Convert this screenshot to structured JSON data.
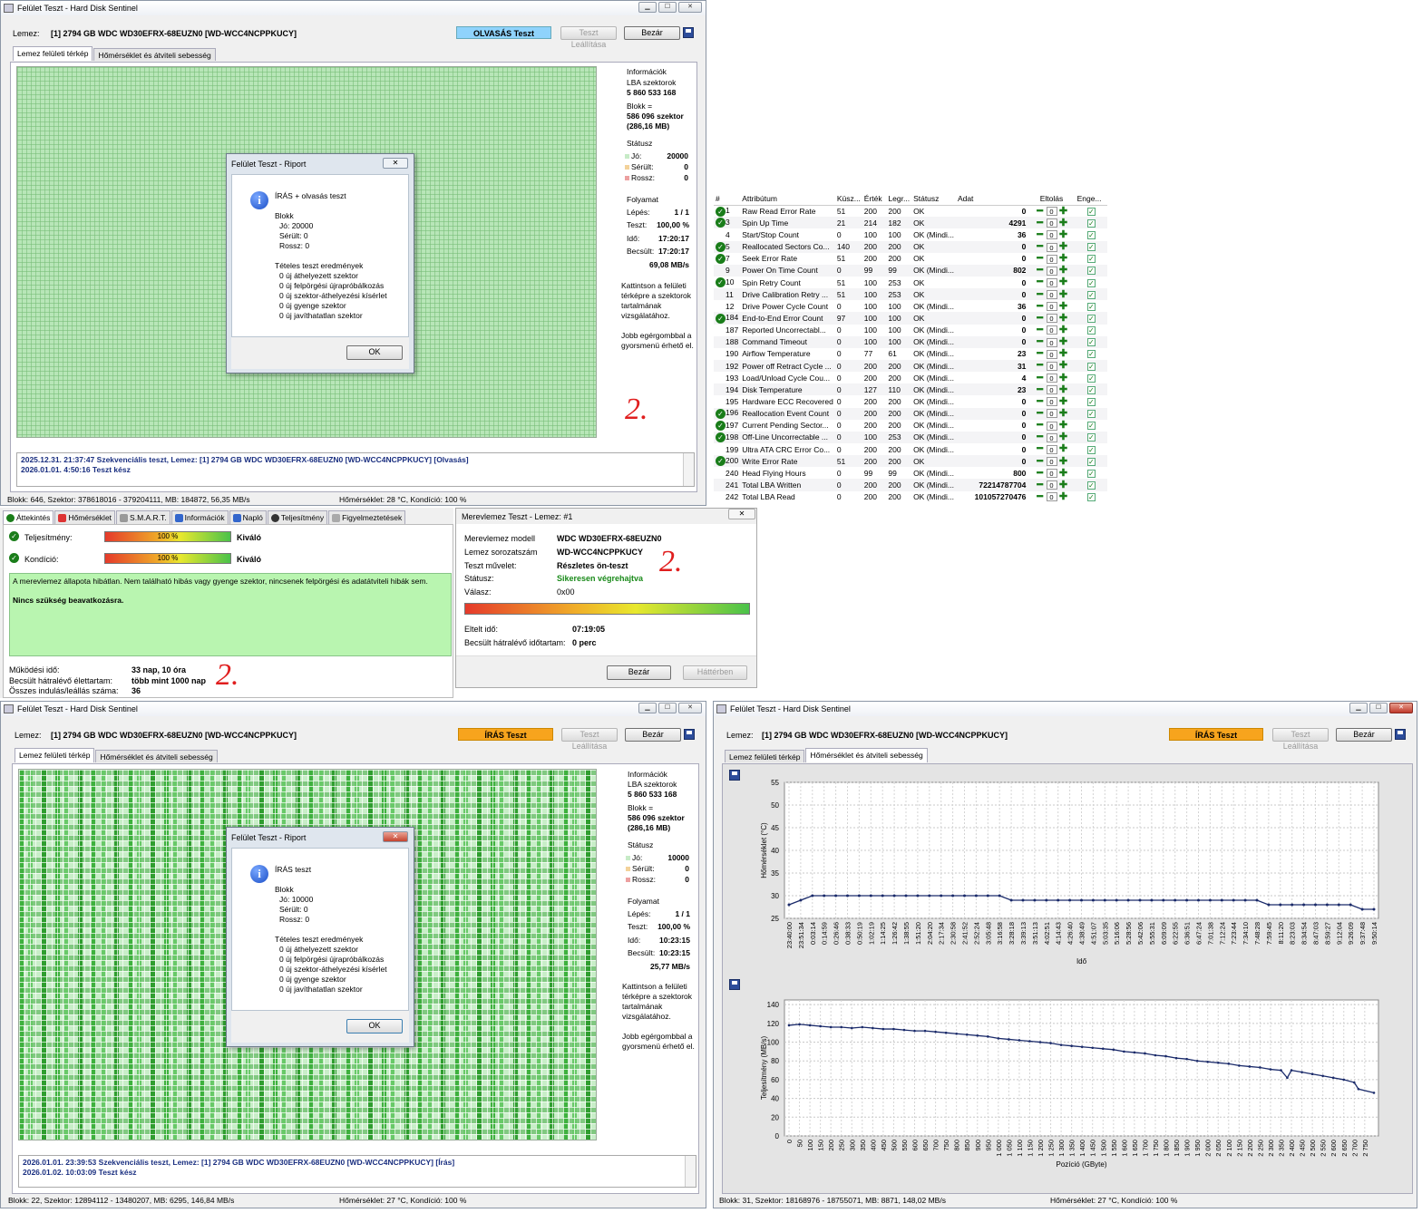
{
  "win_read": {
    "title": "Felület Teszt - Hard Disk Sentinel",
    "disk_label": "Lemez:",
    "disk_value": "[1] 2794 GB  WDC WD30EFRX-68EUZN0 [WD-WCC4NCPPKUCY]",
    "mode": "OLVASÁS Teszt",
    "stop": "Teszt Leállítása",
    "close": "Bezár",
    "tab1": "Lemez felületi térkép",
    "tab2": "Hőmérséklet és átviteli sebesség",
    "info_title": "Információk",
    "lba_label": "LBA szektorok",
    "lba_value": "5 860 533 168",
    "block_label": "Blokk =",
    "block_value1": "586 096 szektor",
    "block_value2": "(286,16 MB)",
    "status_title": "Státusz",
    "good_label": "Jó:",
    "good_value": "20000",
    "damaged_label": "Sérült:",
    "damaged_value": "0",
    "bad_label": "Rossz:",
    "bad_value": "0",
    "progress_title": "Folyamat",
    "step_label": "Lépés:",
    "step_value": "1 / 1",
    "test_label": "Teszt:",
    "test_value": "100,00 %",
    "time_label": "Idő:",
    "time_value": "17:20:17",
    "est_label": "Becsült:",
    "est_value": "17:20:17",
    "speed": "69,08 MB/s",
    "help1": "Kattintson a felületi térképre a szektorok tartalmának vizsgálatához.",
    "help2": "Jobb egérgombbal a gyorsmenü érhető el.",
    "log1": "2025.12.31.  21:37:47   Szekvenciális teszt, Lemez: [1] 2794 GB  WDC WD30EFRX-68EUZN0 [WD-WCC4NCPPKUCY] [Olvasás]",
    "log2": "2026.01.01.  4:50:16   Teszt kész",
    "status_left": "Blokk: 646, Szektor: 378618016 - 379204111, MB: 184872, 56,35 MB/s",
    "status_right": "Hőmérséklet: 28  °C,  Kondíció: 100 %",
    "handwritten": "2."
  },
  "dlg_read": {
    "title": "Felület Teszt - Riport",
    "line1": "ÍRÁS + olvasás teszt",
    "blocks": "Blokk",
    "good": "Jó: 20000",
    "damaged": "Sérült: 0",
    "bad": "Rossz: 0",
    "results": "Tételes teszt eredmények",
    "r1": "0 új áthelyezett szektor",
    "r2": "0 új felpörgési újrapróbálkozás",
    "r3": "0 új szektor-áthelyezési kísérlet",
    "r4": "0 új gyenge szektor",
    "r5": "0 új javíthatatlan szektor",
    "ok": "OK"
  },
  "smart": {
    "headers": [
      "#",
      "Attribútum",
      "Küsz...",
      "Érték",
      "Legr...",
      "Státusz",
      "Adat",
      "Eltolás",
      "Enge..."
    ],
    "rows": [
      {
        "ok": true,
        "id": "1",
        "name": "Raw Read Error Rate",
        "th": "51",
        "val": "200",
        "worst": "200",
        "st": "OK",
        "data": "0"
      },
      {
        "ok": true,
        "id": "3",
        "name": "Spin Up Time",
        "th": "21",
        "val": "214",
        "worst": "182",
        "st": "OK",
        "data": "4291"
      },
      {
        "ok": false,
        "id": "4",
        "name": "Start/Stop Count",
        "th": "0",
        "val": "100",
        "worst": "100",
        "st": "OK (Mindi...",
        "data": "36"
      },
      {
        "ok": true,
        "id": "5",
        "name": "Reallocated Sectors Co...",
        "th": "140",
        "val": "200",
        "worst": "200",
        "st": "OK",
        "data": "0"
      },
      {
        "ok": true,
        "id": "7",
        "name": "Seek Error Rate",
        "th": "51",
        "val": "200",
        "worst": "200",
        "st": "OK",
        "data": "0"
      },
      {
        "ok": false,
        "id": "9",
        "name": "Power On Time Count",
        "th": "0",
        "val": "99",
        "worst": "99",
        "st": "OK (Mindi...",
        "data": "802"
      },
      {
        "ok": true,
        "id": "10",
        "name": "Spin Retry Count",
        "th": "51",
        "val": "100",
        "worst": "253",
        "st": "OK",
        "data": "0"
      },
      {
        "ok": false,
        "id": "11",
        "name": "Drive Calibration Retry ...",
        "th": "51",
        "val": "100",
        "worst": "253",
        "st": "OK",
        "data": "0"
      },
      {
        "ok": false,
        "id": "12",
        "name": "Drive Power Cycle Count",
        "th": "0",
        "val": "100",
        "worst": "100",
        "st": "OK (Mindi...",
        "data": "36"
      },
      {
        "ok": true,
        "id": "184",
        "name": "End-to-End Error Count",
        "th": "97",
        "val": "100",
        "worst": "100",
        "st": "OK",
        "data": "0"
      },
      {
        "ok": false,
        "id": "187",
        "name": "Reported Uncorrectabl...",
        "th": "0",
        "val": "100",
        "worst": "100",
        "st": "OK (Mindi...",
        "data": "0"
      },
      {
        "ok": false,
        "id": "188",
        "name": "Command Timeout",
        "th": "0",
        "val": "100",
        "worst": "100",
        "st": "OK (Mindi...",
        "data": "0"
      },
      {
        "ok": false,
        "id": "190",
        "name": "Airflow Temperature",
        "th": "0",
        "val": "77",
        "worst": "61",
        "st": "OK (Mindi...",
        "data": "23"
      },
      {
        "ok": false,
        "id": "192",
        "name": "Power off Retract Cycle ...",
        "th": "0",
        "val": "200",
        "worst": "200",
        "st": "OK (Mindi...",
        "data": "31"
      },
      {
        "ok": false,
        "id": "193",
        "name": "Load/Unload Cycle Cou...",
        "th": "0",
        "val": "200",
        "worst": "200",
        "st": "OK (Mindi...",
        "data": "4"
      },
      {
        "ok": false,
        "id": "194",
        "name": "Disk Temperature",
        "th": "0",
        "val": "127",
        "worst": "110",
        "st": "OK (Mindi...",
        "data": "23"
      },
      {
        "ok": false,
        "id": "195",
        "name": "Hardware ECC Recovered",
        "th": "0",
        "val": "200",
        "worst": "200",
        "st": "OK (Mindi...",
        "data": "0"
      },
      {
        "ok": true,
        "id": "196",
        "name": "Reallocation Event Count",
        "th": "0",
        "val": "200",
        "worst": "200",
        "st": "OK (Mindi...",
        "data": "0"
      },
      {
        "ok": true,
        "id": "197",
        "name": "Current Pending Sector...",
        "th": "0",
        "val": "200",
        "worst": "200",
        "st": "OK (Mindi...",
        "data": "0"
      },
      {
        "ok": true,
        "id": "198",
        "name": "Off-Line Uncorrectable ...",
        "th": "0",
        "val": "100",
        "worst": "253",
        "st": "OK (Mindi...",
        "data": "0"
      },
      {
        "ok": false,
        "id": "199",
        "name": "Ultra ATA CRC Error Co...",
        "th": "0",
        "val": "200",
        "worst": "200",
        "st": "OK (Mindi...",
        "data": "0"
      },
      {
        "ok": true,
        "id": "200",
        "name": "Write Error Rate",
        "th": "51",
        "val": "200",
        "worst": "200",
        "st": "OK",
        "data": "0"
      },
      {
        "ok": false,
        "id": "240",
        "name": "Head Flying Hours",
        "th": "0",
        "val": "99",
        "worst": "99",
        "st": "OK (Mindi...",
        "data": "800"
      },
      {
        "ok": false,
        "id": "241",
        "name": "Total LBA Written",
        "th": "0",
        "val": "200",
        "worst": "200",
        "st": "OK (Mindi...",
        "data": "72214787704"
      },
      {
        "ok": false,
        "id": "242",
        "name": "Total LBA Read",
        "th": "0",
        "val": "200",
        "worst": "200",
        "st": "OK (Mindi...",
        "data": "101057270476"
      }
    ],
    "offset_value": "0"
  },
  "overview": {
    "tabs": [
      "Áttekintés",
      "Hőmérséklet",
      "S.M.A.R.T.",
      "Információk",
      "Napló",
      "Teljesítmény",
      "Figyelmeztetések"
    ],
    "perf_label": "Teljesítmény:",
    "perf_pct": "100 %",
    "perf_word": "Kiváló",
    "perf_fraction": 1.0,
    "cond_label": "Kondíció:",
    "cond_pct": "100 %",
    "cond_word": "Kiváló",
    "cond_fraction": 1.0,
    "msg1": "A merevlemez állapota hibátlan. Nem található hibás vagy gyenge szektor, nincsenek felpörgési és adatátviteli hibák sem.",
    "msg2": "Nincs szükség beavatkozásra.",
    "uptime_label": "Működési idő:",
    "uptime_value": "33 nap, 10 óra",
    "life_label": "Becsült hátralévő élettartam:",
    "life_value": "több mint 1000 nap",
    "starts_label": "Összes indulás/leállás száma:",
    "starts_value": "36",
    "handwritten": "2."
  },
  "selftest": {
    "title": "Merevlemez Teszt - Lemez: #1",
    "close_x": "☒",
    "model_label": "Merevlemez modell",
    "model_value": "WDC WD30EFRX-68EUZN0",
    "serial_label": "Lemez sorozatszám",
    "serial_value": "WD-WCC4NCPPKUCY",
    "op_label": "Teszt művelet:",
    "op_value": "Részletes ön-teszt",
    "status_label": "Státusz:",
    "status_value": "Sikeresen végrehajtva",
    "reply_label": "Válasz:",
    "reply_value": "0x00",
    "progress_fraction": 1.0,
    "elapsed_label": "Eltelt idő:",
    "elapsed_value": "07:19:05",
    "remain_label": "Becsült hátralévő időtartam:",
    "remain_value": "0 perc",
    "close": "Bezár",
    "background": "Háttérben",
    "handwritten": "2."
  },
  "win_write": {
    "title": "Felület Teszt - Hard Disk Sentinel",
    "disk_label": "Lemez:",
    "disk_value": "[1] 2794 GB  WDC WD30EFRX-68EUZN0 [WD-WCC4NCPPKUCY]",
    "mode": "ÍRÁS Teszt",
    "stop": "Teszt Leállítása",
    "close": "Bezár",
    "tab1": "Lemez felületi térkép",
    "tab2": "Hőmérséklet és átviteli sebesség",
    "info_title": "Információk",
    "lba_label": "LBA szektorok",
    "lba_value": "5 860 533 168",
    "block_label": "Blokk =",
    "block_value1": "586 096 szektor",
    "block_value2": "(286,16 MB)",
    "status_title": "Státusz",
    "good_label": "Jó:",
    "good_value": "10000",
    "damaged_label": "Sérült:",
    "damaged_value": "0",
    "bad_label": "Rossz:",
    "bad_value": "0",
    "progress_title": "Folyamat",
    "step_label": "Lépés:",
    "step_value": "1 / 1",
    "test_label": "Teszt:",
    "test_value": "100,00 %",
    "time_label": "Idő:",
    "time_value": "10:23:15",
    "est_label": "Becsült:",
    "est_value": "10:23:15",
    "speed": "25,77 MB/s",
    "help1": "Kattintson a felületi térképre a szektorok tartalmának vizsgálatához.",
    "help2": "Jobb egérgombbal a gyorsmenü érhető el.",
    "log1": "2026.01.01.  23:39:53   Szekvenciális teszt, Lemez: [1] 2794 GB  WDC WD30EFRX-68EUZN0 [WD-WCC4NCPPKUCY] [Írás]",
    "log2": "2026.01.02.  10:03:09   Teszt kész",
    "status_left": "Blokk: 22, Szektor: 12894112 - 13480207, MB: 6295, 146,84 MB/s",
    "status_right": "Hőmérséklet: 27  °C,  Kondíció: 100 %"
  },
  "dlg_write": {
    "title": "Felület Teszt - Riport",
    "line1": "ÍRÁS teszt",
    "blocks": "Blokk",
    "good": "Jó: 10000",
    "damaged": "Sérült: 0",
    "bad": "Rossz: 0",
    "results": "Tételes teszt eredmények",
    "r1": "0 új áthelyezett szektor",
    "r2": "0 új felpörgési újrapróbálkozás",
    "r3": "0 új szektor-áthelyezési kísérlet",
    "r4": "0 új gyenge szektor",
    "r5": "0 új javíthatatlan szektor",
    "ok": "OK"
  },
  "win_chart": {
    "title": "Felület Teszt - Hard Disk Sentinel",
    "disk_label": "Lemez:",
    "disk_value": "[1] 2794 GB  WDC WD30EFRX-68EUZN0 [WD-WCC4NCPPKUCY]",
    "mode": "ÍRÁS Teszt",
    "stop": "Teszt Leállítása",
    "close": "Bezár",
    "tab1": "Lemez felületi térkép",
    "tab2": "Hőmérséklet és átviteli sebesség",
    "status_left": "Blokk: 31, Szektor: 18168976 - 18755071, MB: 8871, 148,02 MB/s",
    "status_right": "Hőmérséklet: 27  °C,  Kondíció: 100 %"
  },
  "chart_data": [
    {
      "type": "line",
      "xlabel": "Idő",
      "ylabel": "Hőmérséklet (°C)",
      "ylim": [
        25,
        55
      ],
      "yticks": [
        25,
        30,
        35,
        40,
        45,
        50,
        55
      ],
      "grid": true,
      "x": [
        "23:40:00",
        "23:51:34",
        "0:03:14",
        "0:14:59",
        "0:26:46",
        "0:38:33",
        "0:50:19",
        "1:02:19",
        "1:14:25",
        "1:26:42",
        "1:38:55",
        "1:51:20",
        "2:04:20",
        "2:17:34",
        "2:30:58",
        "2:41:52",
        "2:52:24",
        "3:05:48",
        "3:16:58",
        "3:28:18",
        "3:39:13",
        "3:51:13",
        "4:02:51",
        "4:14:43",
        "4:26:40",
        "4:38:49",
        "4:51:07",
        "5:03:35",
        "5:16:06",
        "5:28:56",
        "5:42:06",
        "5:55:31",
        "6:09:09",
        "6:22:55",
        "6:36:51",
        "6:47:24",
        "7:01:38",
        "7:12:24",
        "7:23:44",
        "7:34:10",
        "7:48:28",
        "7:59:45",
        "8:11:20",
        "8:23:03",
        "8:34:54",
        "8:47:03",
        "8:59:27",
        "9:12:04",
        "9:26:09",
        "9:37:48",
        "9:50:14"
      ],
      "series": [
        {
          "values": [
            28,
            29,
            30,
            30,
            30,
            30,
            30,
            30,
            30,
            30,
            30,
            30,
            30,
            30,
            30,
            30,
            30,
            30,
            30,
            29,
            29,
            29,
            29,
            29,
            29,
            29,
            29,
            29,
            29,
            29,
            29,
            29,
            29,
            29,
            29,
            29,
            29,
            29,
            29,
            29,
            29,
            28,
            28,
            28,
            28,
            28,
            28,
            28,
            28,
            27,
            27
          ]
        }
      ]
    },
    {
      "type": "line",
      "xlabel": "Pozíció (GByte)",
      "ylabel": "Teljesítmény (MB/s)",
      "ylim": [
        0,
        145
      ],
      "yticks": [
        0,
        20,
        40,
        60,
        80,
        100,
        120,
        140
      ],
      "xlim": [
        0,
        2794
      ],
      "xticks": [
        0,
        50,
        100,
        150,
        200,
        250,
        300,
        350,
        400,
        450,
        500,
        550,
        600,
        650,
        700,
        750,
        800,
        850,
        900,
        950,
        1000,
        1050,
        1100,
        1150,
        1200,
        1250,
        1300,
        1350,
        1400,
        1450,
        1500,
        1550,
        1600,
        1650,
        1700,
        1750,
        1800,
        1850,
        1900,
        1950,
        2000,
        2050,
        2100,
        2150,
        2200,
        2250,
        2300,
        2350,
        2400,
        2450,
        2500,
        2550,
        2600,
        2650,
        2700,
        2750
      ],
      "xtick_labels": [
        "0",
        "50",
        "100",
        "150",
        "200",
        "250",
        "300",
        "350",
        "400",
        "450",
        "500",
        "550",
        "600",
        "650",
        "700",
        "750",
        "800",
        "850",
        "900",
        "950",
        "1 000",
        "1 050",
        "1 100",
        "1 150",
        "1 200",
        "1 250",
        "1 300",
        "1 350",
        "1 400",
        "1 450",
        "1 500",
        "1 550",
        "1 600",
        "1 650",
        "1 700",
        "1 750",
        "1 800",
        "1 850",
        "1 900",
        "1 950",
        "2 000",
        "2 050",
        "2 100",
        "2 150",
        "2 200",
        "2 250",
        "2 300",
        "2 350",
        "2 400",
        "2 450",
        "2 500",
        "2 550",
        "2 600",
        "2 650",
        "2 700",
        "2 750"
      ],
      "grid": true,
      "series": [
        {
          "x": [
            0,
            50,
            100,
            150,
            200,
            250,
            300,
            350,
            400,
            450,
            500,
            550,
            600,
            650,
            700,
            750,
            800,
            850,
            900,
            950,
            1000,
            1050,
            1100,
            1150,
            1200,
            1250,
            1300,
            1350,
            1400,
            1450,
            1500,
            1550,
            1600,
            1650,
            1700,
            1750,
            1800,
            1850,
            1900,
            1950,
            2000,
            2050,
            2100,
            2150,
            2200,
            2250,
            2300,
            2350,
            2380,
            2400,
            2450,
            2500,
            2550,
            2600,
            2650,
            2700,
            2720,
            2794
          ],
          "values": [
            118,
            119,
            118,
            117,
            116,
            116,
            115,
            116,
            115,
            114,
            114,
            113,
            112,
            112,
            111,
            110,
            109,
            108,
            107,
            106,
            104,
            103,
            102,
            101,
            100,
            99,
            97,
            96,
            95,
            94,
            93,
            92,
            90,
            89,
            88,
            86,
            85,
            83,
            82,
            80,
            79,
            78,
            77,
            75,
            74,
            73,
            71,
            70,
            62,
            70,
            68,
            66,
            64,
            62,
            60,
            57,
            50,
            46
          ]
        }
      ]
    }
  ]
}
